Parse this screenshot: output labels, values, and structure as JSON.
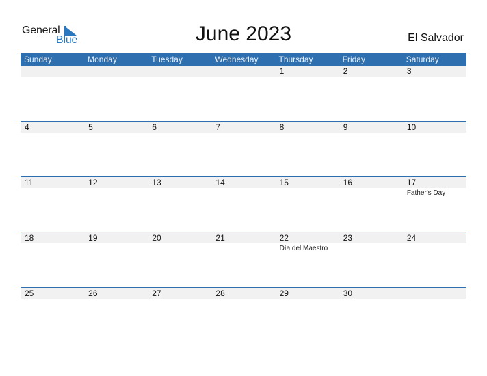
{
  "logo": {
    "word1": "General",
    "word2": "Blue"
  },
  "title": "June 2023",
  "country": "El Salvador",
  "colors": {
    "accent": "#2e6faf",
    "logo_blue": "#2a78c2",
    "band": "#f1f1f1"
  },
  "weekdays": [
    "Sunday",
    "Monday",
    "Tuesday",
    "Wednesday",
    "Thursday",
    "Friday",
    "Saturday"
  ],
  "weeks": [
    {
      "days": [
        "",
        "",
        "",
        "",
        "1",
        "2",
        "3"
      ],
      "events": [
        "",
        "",
        "",
        "",
        "",
        "",
        ""
      ]
    },
    {
      "days": [
        "4",
        "5",
        "6",
        "7",
        "8",
        "9",
        "10"
      ],
      "events": [
        "",
        "",
        "",
        "",
        "",
        "",
        ""
      ]
    },
    {
      "days": [
        "11",
        "12",
        "13",
        "14",
        "15",
        "16",
        "17"
      ],
      "events": [
        "",
        "",
        "",
        "",
        "",
        "",
        "Father's Day"
      ]
    },
    {
      "days": [
        "18",
        "19",
        "20",
        "21",
        "22",
        "23",
        "24"
      ],
      "events": [
        "",
        "",
        "",
        "",
        "Día del Maestro",
        "",
        ""
      ]
    },
    {
      "days": [
        "25",
        "26",
        "27",
        "28",
        "29",
        "30",
        ""
      ],
      "events": [
        "",
        "",
        "",
        "",
        "",
        "",
        ""
      ]
    }
  ]
}
